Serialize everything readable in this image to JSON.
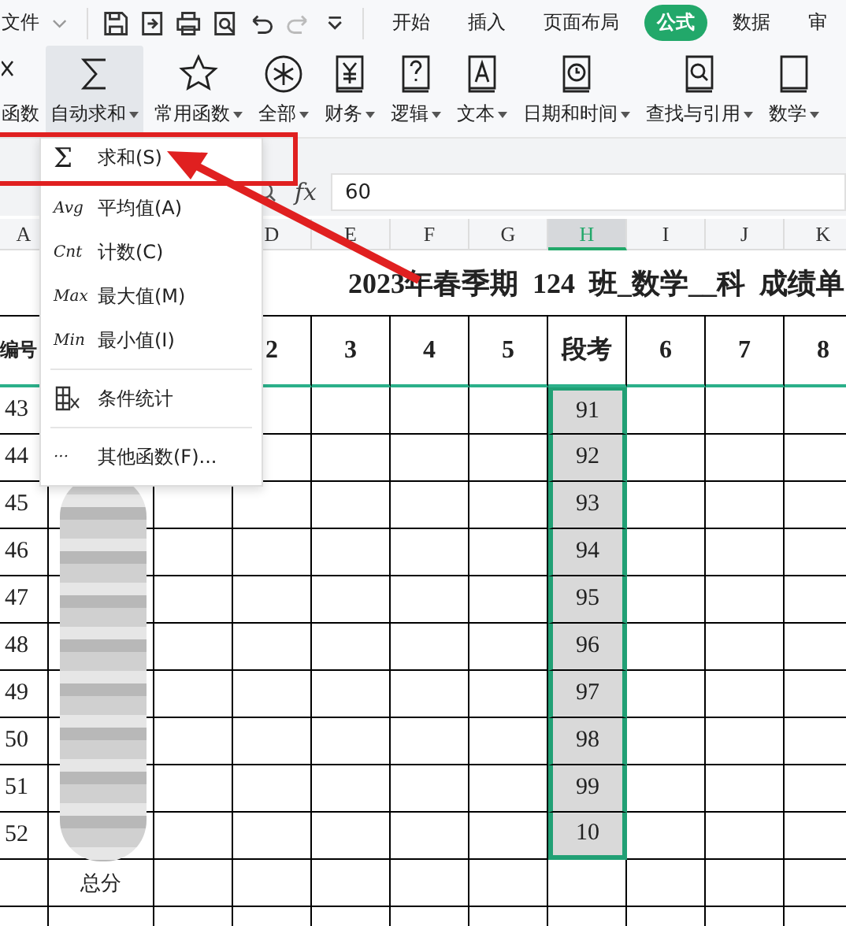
{
  "quick_bar": {
    "file_menu": "文件",
    "tools": [
      {
        "kind": "save",
        "disabled": false
      },
      {
        "kind": "export",
        "disabled": false
      },
      {
        "kind": "print",
        "disabled": false
      },
      {
        "kind": "preview",
        "disabled": false
      },
      {
        "kind": "undo",
        "disabled": false
      },
      {
        "kind": "redo",
        "disabled": true
      },
      {
        "kind": "more",
        "disabled": false
      }
    ]
  },
  "menu_tabs": [
    {
      "label": "开始",
      "selected": false
    },
    {
      "label": "插入",
      "selected": false
    },
    {
      "label": "页面布局",
      "selected": false
    },
    {
      "label": "公式",
      "selected": true
    },
    {
      "label": "数据",
      "selected": false
    },
    {
      "label": "审",
      "selected": false
    }
  ],
  "ribbon": {
    "left_label": "函数",
    "buttons": [
      {
        "kind": "sigma",
        "label": "自动求和",
        "selected": true
      },
      {
        "kind": "star",
        "label": "常用函数",
        "selected": false
      },
      {
        "kind": "asterisk",
        "label": "全部",
        "selected": false
      },
      {
        "kind": "yen",
        "label": "财务",
        "selected": false
      },
      {
        "kind": "question",
        "label": "逻辑",
        "selected": false
      },
      {
        "kind": "letter",
        "label": "文本",
        "selected": false
      },
      {
        "kind": "clock",
        "label": "日期和时间",
        "selected": false
      },
      {
        "kind": "search",
        "label": "查找与引用",
        "selected": false
      },
      {
        "kind": "book",
        "label": "数学",
        "selected": false
      }
    ]
  },
  "formula_bar": {
    "fx": "fx",
    "value": "60"
  },
  "sheet": {
    "column_headers": [
      {
        "label": "A",
        "selected": false
      },
      {
        "label": "D",
        "selected": false
      },
      {
        "label": "E",
        "selected": false
      },
      {
        "label": "F",
        "selected": false
      },
      {
        "label": "G",
        "selected": false
      },
      {
        "label": "H",
        "selected": true
      },
      {
        "label": "I",
        "selected": false
      },
      {
        "label": "J",
        "selected": false
      },
      {
        "label": "K",
        "selected": false
      }
    ],
    "title": "2023年春季期  124  班_数学__科  成绩单",
    "header_cells": [
      "编号",
      "2",
      "3",
      "4",
      "5",
      "段考",
      "6",
      "7",
      "8"
    ],
    "rows": [
      {
        "number": "43",
        "score": "91"
      },
      {
        "number": "44",
        "score": "92"
      },
      {
        "number": "45",
        "score": "93"
      },
      {
        "number": "46",
        "score": "94"
      },
      {
        "number": "47",
        "score": "95"
      },
      {
        "number": "48",
        "score": "96"
      },
      {
        "number": "49",
        "score": "97"
      },
      {
        "number": "50",
        "score": "98"
      },
      {
        "number": "51",
        "score": "99"
      },
      {
        "number": "52",
        "score": "10"
      }
    ],
    "total_label": "总分"
  },
  "autosum_menu": {
    "items": [
      {
        "kind": "glyph",
        "glyph": "Σ",
        "label": "求和(S)",
        "separated": false
      },
      {
        "kind": "glyph",
        "glyph": "Avg",
        "label": "平均值(A)",
        "separated": false
      },
      {
        "kind": "glyph",
        "glyph": "Cnt",
        "label": "计数(C)",
        "separated": false
      },
      {
        "kind": "glyph",
        "glyph": "Max",
        "label": "最大值(M)",
        "separated": false
      },
      {
        "kind": "glyph",
        "glyph": "Min",
        "label": "最小值(I)",
        "separated": false
      },
      {
        "kind": "table-icon",
        "label": "条件统计",
        "separated": true
      },
      {
        "kind": "glyph",
        "glyph": "···",
        "label": "其他函数(F)...",
        "separated": true
      }
    ]
  }
}
